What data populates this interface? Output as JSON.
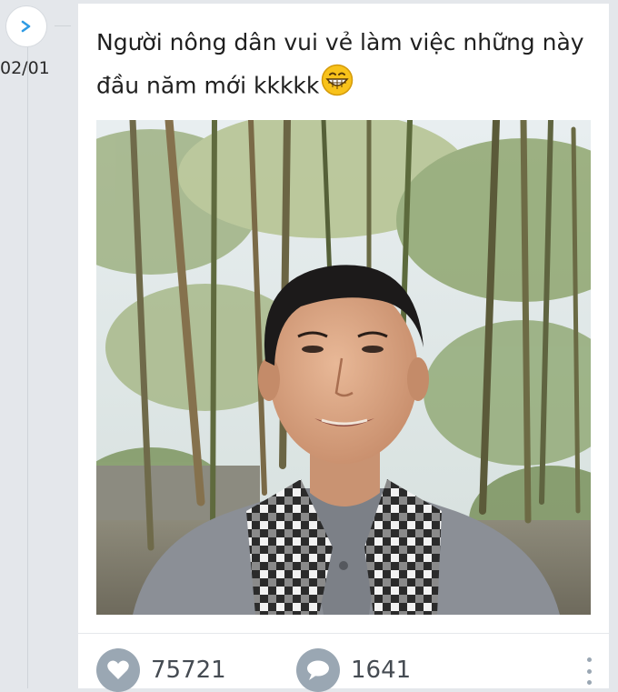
{
  "timeline": {
    "date": "02/01",
    "icon": "chevron-right-icon",
    "accent": "#2f9be4"
  },
  "post": {
    "text": "Người nông dân vui vẻ làm việc những này đầu năm mới kkkkk",
    "emoji": "grinning-face-emoji",
    "photo": "portrait-in-bamboo-grove"
  },
  "actions": {
    "likes": "75721",
    "comments": "1641",
    "like_icon": "heart-icon",
    "comment_icon": "speech-bubble-icon",
    "more_icon": "vertical-dots-icon"
  },
  "colors": {
    "background": "#e4e7eb",
    "card": "#ffffff",
    "action_icon": "#9aa7b3"
  }
}
